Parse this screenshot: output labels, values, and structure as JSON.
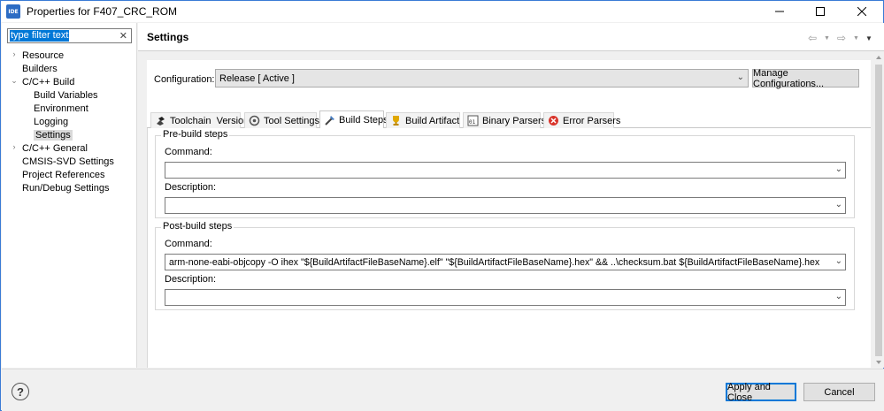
{
  "window": {
    "title": "Properties for F407_CRC_ROM",
    "icon_text": "IDE"
  },
  "sidebar": {
    "filter_text": "type filter text",
    "clear_glyph": "✕",
    "items": [
      {
        "label": "Resource",
        "arrow": "›"
      },
      {
        "label": "Builders",
        "arrow": ""
      },
      {
        "label": "C/C++ Build",
        "arrow": "⌄"
      },
      {
        "label": "Build Variables",
        "arrow": ""
      },
      {
        "label": "Environment",
        "arrow": ""
      },
      {
        "label": "Logging",
        "arrow": ""
      },
      {
        "label": "Settings",
        "arrow": "",
        "selected": true
      },
      {
        "label": "C/C++ General",
        "arrow": "›"
      },
      {
        "label": "CMSIS-SVD Settings",
        "arrow": ""
      },
      {
        "label": "Project References",
        "arrow": ""
      },
      {
        "label": "Run/Debug Settings",
        "arrow": ""
      }
    ]
  },
  "header": {
    "title": "Settings"
  },
  "config": {
    "label": "Configuration:",
    "value": "Release  [ Active ]",
    "manage_label": "Manage Configurations..."
  },
  "tabs": [
    {
      "label": "Toolchain  Version",
      "icon": "toolchain-icon"
    },
    {
      "label": "Tool Settings",
      "icon": "tool-settings-icon"
    },
    {
      "label": "Build Steps",
      "icon": "build-steps-icon",
      "active": true
    },
    {
      "label": "Build Artifact",
      "icon": "trophy-icon"
    },
    {
      "label": "Binary Parsers",
      "icon": "binary-icon"
    },
    {
      "label": "Error Parsers",
      "icon": "error-icon"
    }
  ],
  "pre_build": {
    "title": "Pre-build steps",
    "command_label": "Command:",
    "command_value": "",
    "description_label": "Description:",
    "description_value": ""
  },
  "post_build": {
    "title": "Post-build steps",
    "command_label": "Command:",
    "command_value": "arm-none-eabi-objcopy -O ihex \"${BuildArtifactFileBaseName}.elf\" \"${BuildArtifactFileBaseName}.hex\" && ..\\checksum.bat ${BuildArtifactFileBaseName}.hex",
    "description_label": "Description:",
    "description_value": ""
  },
  "buttons": {
    "help": "?",
    "apply_close": "Apply and Close",
    "cancel": "Cancel"
  },
  "colors": {
    "accent": "#0078d7",
    "window_border": "#3a7bd5"
  }
}
